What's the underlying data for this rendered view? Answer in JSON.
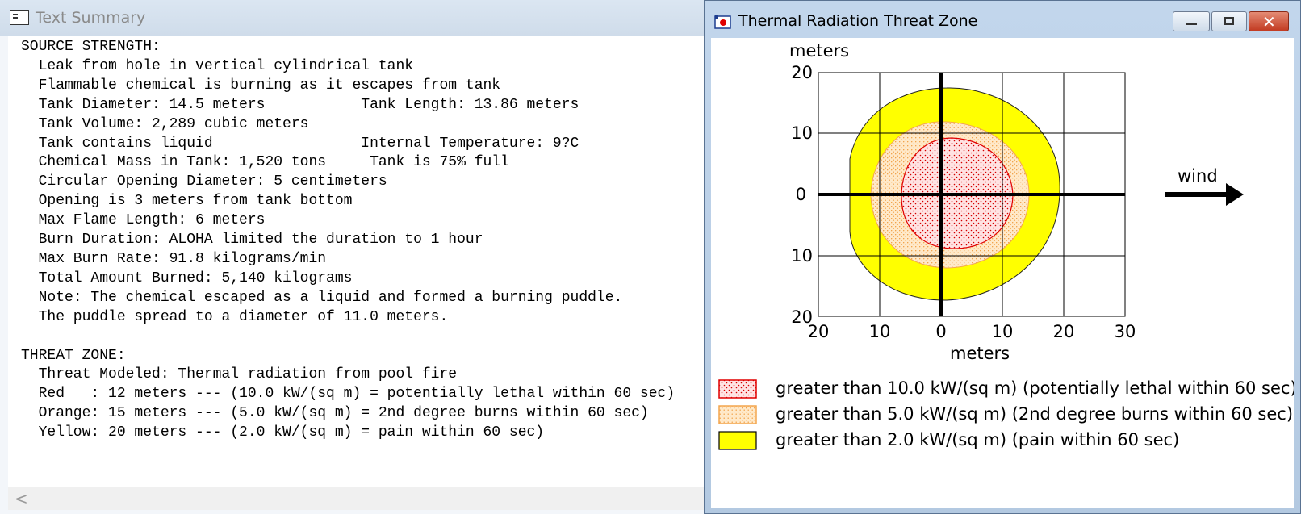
{
  "left_window": {
    "title": "Text Summary",
    "lines": [
      "SOURCE STRENGTH:",
      "  Leak from hole in vertical cylindrical tank",
      "  Flammable chemical is burning as it escapes from tank",
      "  Tank Diameter: 14.5 meters           Tank Length: 13.86 meters",
      "  Tank Volume: 2,289 cubic meters",
      "  Tank contains liquid                 Internal Temperature: 9?C",
      "  Chemical Mass in Tank: 1,520 tons     Tank is 75% full",
      "  Circular Opening Diameter: 5 centimeters",
      "  Opening is 3 meters from tank bottom",
      "  Max Flame Length: 6 meters",
      "  Burn Duration: ALOHA limited the duration to 1 hour",
      "  Max Burn Rate: 91.8 kilograms/min",
      "  Total Amount Burned: 5,140 kilograms",
      "  Note: The chemical escaped as a liquid and formed a burning puddle.",
      "  The puddle spread to a diameter of 11.0 meters.",
      "",
      "THREAT ZONE:",
      "  Threat Modeled: Thermal radiation from pool fire",
      "  Red   : 12 meters --- (10.0 kW/(sq m) = potentially lethal within 60 sec)",
      "  Orange: 15 meters --- (5.0 kW/(sq m) = 2nd degree burns within 60 sec)",
      "  Yellow: 20 meters --- (2.0 kW/(sq m) = pain within 60 sec)"
    ],
    "scroll_left_glyph": "<"
  },
  "right_window": {
    "title": "Thermal Radiation Threat Zone",
    "buttons": {
      "close_glyph": "✕"
    },
    "plot": {
      "y_unit": "meters",
      "x_unit": "meters",
      "y_ticks": [
        "20",
        "10",
        "0",
        "10",
        "20"
      ],
      "x_ticks": [
        "20",
        "10",
        "0",
        "10",
        "20",
        "30"
      ],
      "wind_label": "wind"
    },
    "legend": [
      {
        "label": "greater than 10.0 kW/(sq m) (potentially lethal within 60 sec)",
        "color": "#ff0000"
      },
      {
        "label": "greater than 5.0 kW/(sq m) (2nd degree burns within 60 sec)",
        "color": "#f7b25f"
      },
      {
        "label": "greater than 2.0 kW/(sq m) (pain within 60 sec)",
        "color": "#ffff00"
      }
    ],
    "colors": {
      "red": "#e00000",
      "orange": "#f5a54a",
      "yellow": "#ffff00",
      "pale_red": "#ffd6d6",
      "pale_orange": "#fde3c0"
    }
  }
}
